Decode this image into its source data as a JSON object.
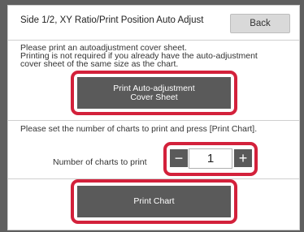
{
  "header": {
    "title": "Side 1/2, XY Ratio/Print Position Auto Adjust",
    "back_label": "Back"
  },
  "message1": {
    "line1": "Please print an autoadjustment cover sheet.",
    "line2": "Printing is not required if you already have the auto-adjustment",
    "line3": "cover sheet of the same size as the chart."
  },
  "cover_button": {
    "line1": "Print Auto-adjustment",
    "line2": "Cover Sheet"
  },
  "message2": "Please set the number of charts to print and press [Print Chart].",
  "charts": {
    "label": "Number of charts to print",
    "value": "1",
    "minus": "−",
    "plus": "+"
  },
  "print_chart_label": "Print Chart",
  "colors": {
    "highlight": "#d3213b",
    "button_dark": "#5a5a5a",
    "button_light": "#d9d9d9"
  }
}
